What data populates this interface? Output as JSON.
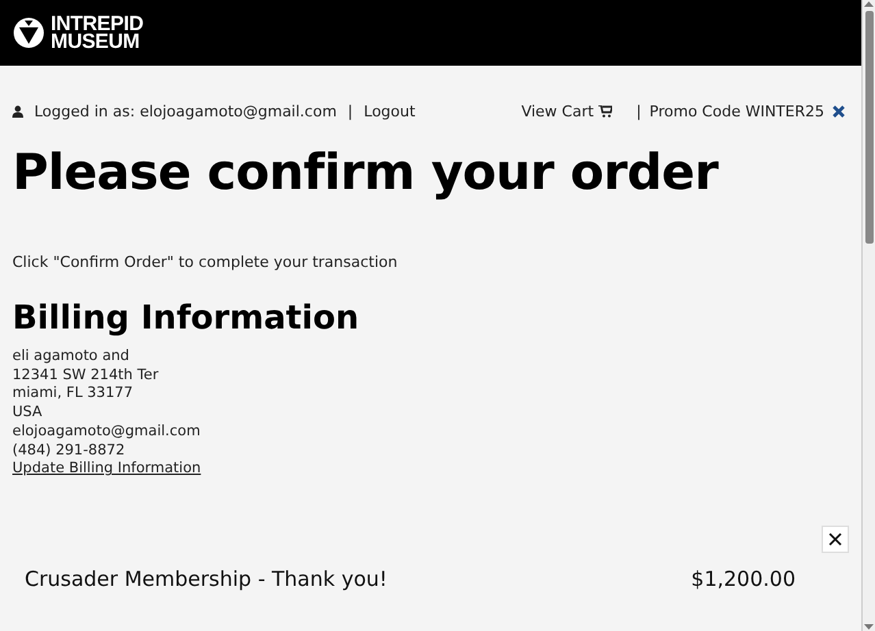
{
  "header": {
    "logo_lines": [
      "INTREPID",
      "MUSEUM"
    ]
  },
  "account_bar": {
    "logged_in_label": "Logged in as: elojoagamoto@gmail.com",
    "separator": "|",
    "logout": "Logout",
    "view_cart": "View Cart",
    "promo_separator": "|",
    "promo": "Promo Code WINTER25"
  },
  "title": "Please confirm your order",
  "instruction": "Click \"Confirm Order\" to complete your transaction",
  "billing": {
    "heading": "Billing Information",
    "lines": [
      "eli agamoto and",
      "12341 SW 214th Ter",
      "miami, FL 33177",
      "USA",
      "elojoagamoto@gmail.com",
      "(484) 291-8872"
    ],
    "update_link": "Update Billing Information"
  },
  "order_items": [
    {
      "name": "Crusader Membership - Thank you!",
      "price": "$1,200.00"
    }
  ]
}
